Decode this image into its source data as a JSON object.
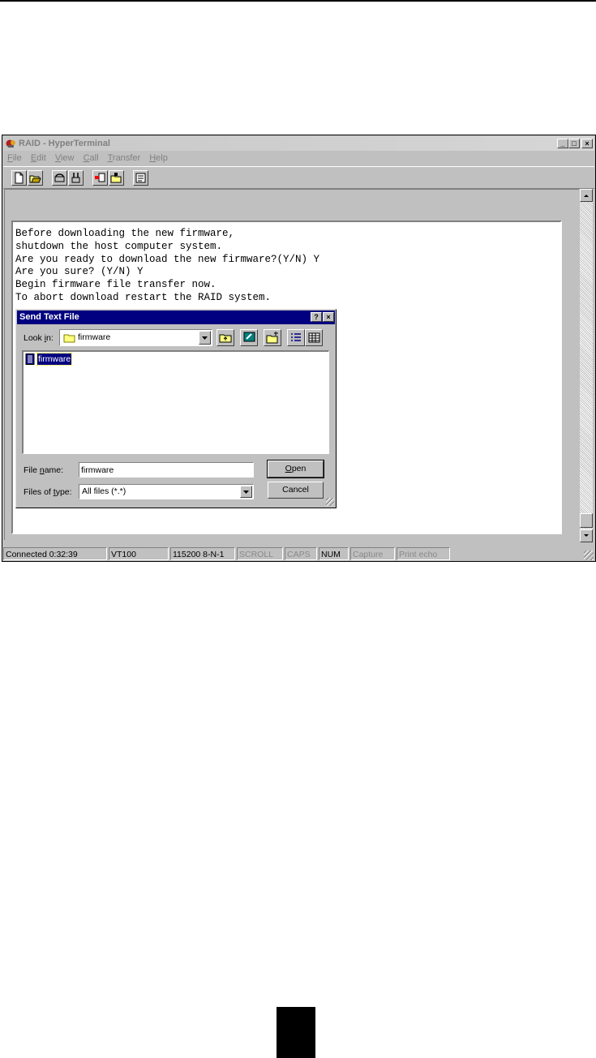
{
  "window": {
    "title": "RAID - HyperTerminal",
    "controls": {
      "minimize": "_",
      "maximize": "□",
      "close": "×"
    }
  },
  "menu": {
    "items": [
      {
        "accel": "F",
        "rest": "ile"
      },
      {
        "accel": "E",
        "rest": "dit"
      },
      {
        "accel": "V",
        "rest": "iew"
      },
      {
        "accel": "C",
        "rest": "all"
      },
      {
        "accel": "T",
        "rest": "ransfer"
      },
      {
        "accel": "H",
        "rest": "elp"
      }
    ]
  },
  "toolbar": {
    "icons": [
      "new-icon",
      "open-icon",
      "connect-icon",
      "disconnect-icon",
      "send-icon",
      "receive-icon",
      "properties-icon"
    ]
  },
  "terminal": {
    "lines": [
      "Before downloading the new firmware,",
      "shutdown the host computer system.",
      "Are you ready to download the new firmware?(Y/N) Y",
      "Are you sure? (Y/N) Y",
      "Begin firmware file transfer now.",
      "To abort download restart the RAID system."
    ]
  },
  "dialog": {
    "title": "Send Text File",
    "help_btn": "?",
    "close_btn": "×",
    "lookin_label_pre": "Look ",
    "lookin_label_accel": "i",
    "lookin_label_post": "n:",
    "lookin_value": "firmware",
    "files": [
      "firmware"
    ],
    "filename_label_pre": "File ",
    "filename_label_accel": "n",
    "filename_label_post": "ame:",
    "filename_value": "firmware",
    "filetype_label_pre": "Files of ",
    "filetype_label_accel": "t",
    "filetype_label_post": "ype:",
    "filetype_value": "All files (*.*)",
    "open_accel": "O",
    "open_rest": "pen",
    "cancel_label": "Cancel"
  },
  "statusbar": {
    "connected": "Connected 0:32:39",
    "emulation": "VT100",
    "settings": "115200 8-N-1",
    "scroll": "SCROLL",
    "caps": "CAPS",
    "num": "NUM",
    "capture": "Capture",
    "print_echo": "Print echo"
  },
  "colors": {
    "dialog_title_bg": "#000080",
    "window_face": "#c0c0c0"
  }
}
